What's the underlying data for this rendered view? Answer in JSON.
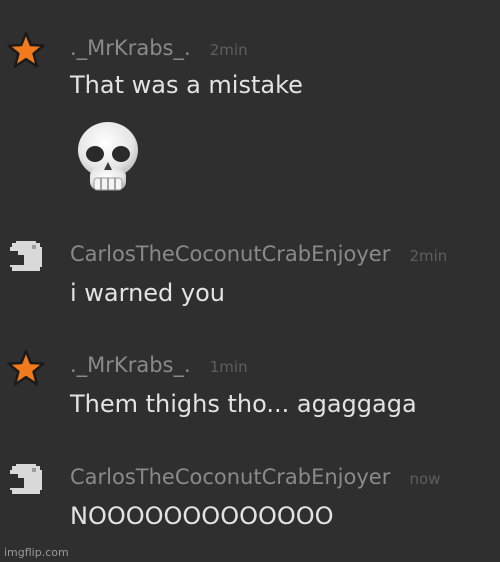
{
  "messages": [
    {
      "avatar_icon": "star-icon",
      "username": "._MrKrabs_.",
      "time": "2min",
      "text": "That was a mistake",
      "attachment_icon": "skull-emoji"
    },
    {
      "avatar_icon": "blocky-avatar-icon",
      "username": "CarlosTheCoconutCrabEnjoyer",
      "time": "2min",
      "text": "i warned you"
    },
    {
      "avatar_icon": "star-icon",
      "username": "._MrKrabs_.",
      "time": "1min",
      "text": "Them thighs tho... agaggaga"
    },
    {
      "avatar_icon": "blocky-avatar-icon",
      "username": "CarlosTheCoconutCrabEnjoyer",
      "time": "now",
      "text": "NOOOOOOOOOOOOO"
    }
  ],
  "watermark": "imgflip.com",
  "colors": {
    "background": "#2f2f2f",
    "username": "#8a8a8a",
    "time": "#5e5e5e",
    "text": "#e3e3e3",
    "star": "#f07a1c",
    "avatar_block": "#d9d9d9"
  }
}
